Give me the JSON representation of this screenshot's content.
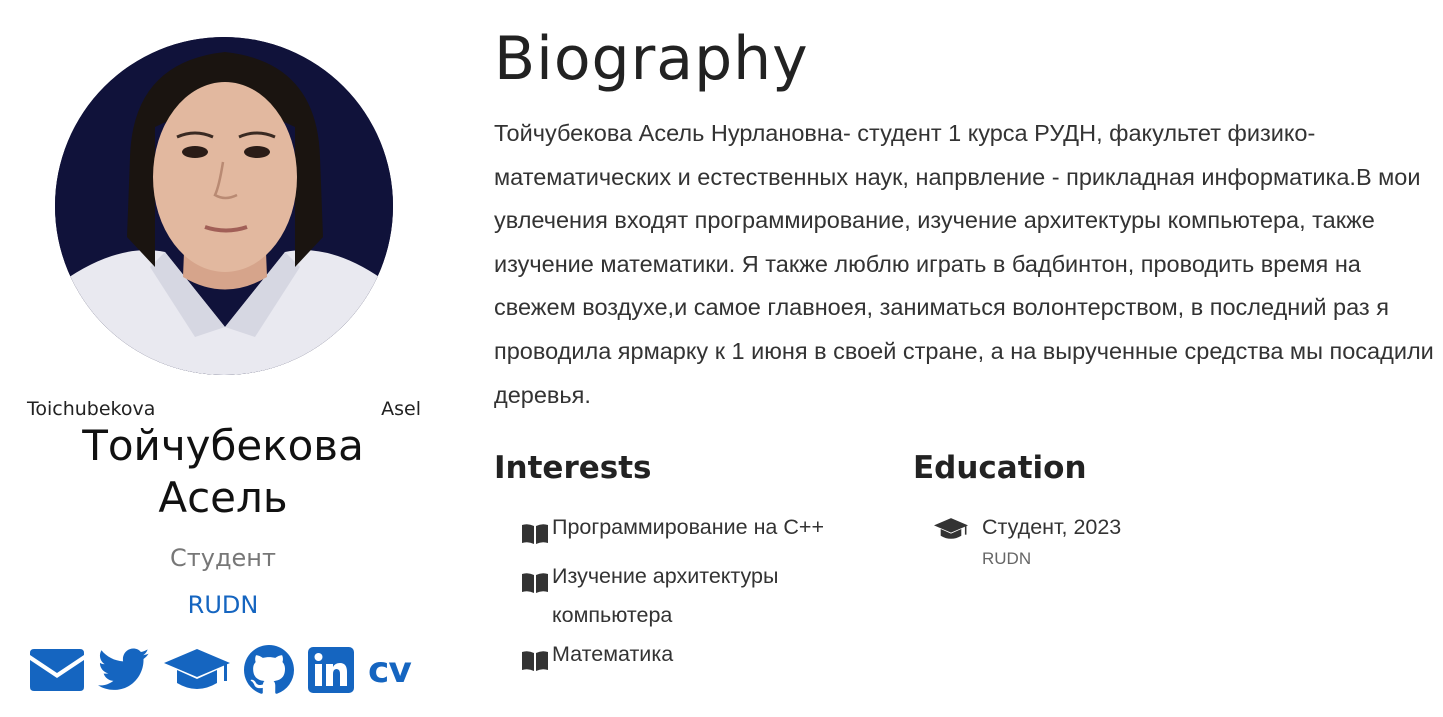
{
  "profile": {
    "portrait_alt_first": "Toichubekova",
    "portrait_alt_last": "Asel",
    "name_line1": "Тойчубекова",
    "name_line2": "Асель",
    "role": "Студент",
    "organization": "RUDN",
    "social": [
      {
        "icon": "envelope-icon"
      },
      {
        "icon": "twitter-icon"
      },
      {
        "icon": "graduation-cap-icon"
      },
      {
        "icon": "github-icon"
      },
      {
        "icon": "linkedin-icon"
      },
      {
        "icon": "cv-icon",
        "label": "cv"
      }
    ]
  },
  "biography": {
    "title": "Biography",
    "text": "Тойчубекова Асель Нурлановна- студент 1 курса РУДН, факультет физико-математических и естественных наук, напрвление - прикладная информатика.В мои увлечения входят программирование, изучение архитектуры компьютера, также изучение математики. Я также люблю играть в бадбинтон, проводить время на свежем воздухе,и самое главноея, заниматься волонтерством, в последний раз я проводила ярмарку к 1 июня в своей стране, а на вырученные средства мы посадили деревья."
  },
  "interests": {
    "title": "Interests",
    "items": [
      {
        "label": "Программирование на C++",
        "icon": "book-icon"
      },
      {
        "label": "Изучение архитектуры компьютера",
        "icon": "book-icon"
      },
      {
        "label": "Математика",
        "icon": "book-icon"
      }
    ]
  },
  "education": {
    "title": "Education",
    "items": [
      {
        "degree": "Студент, 2023",
        "institution": "RUDN",
        "icon": "graduation-cap-icon"
      }
    ]
  },
  "colors": {
    "accent": "#1565c0",
    "text": "#333333",
    "muted": "#777777"
  }
}
